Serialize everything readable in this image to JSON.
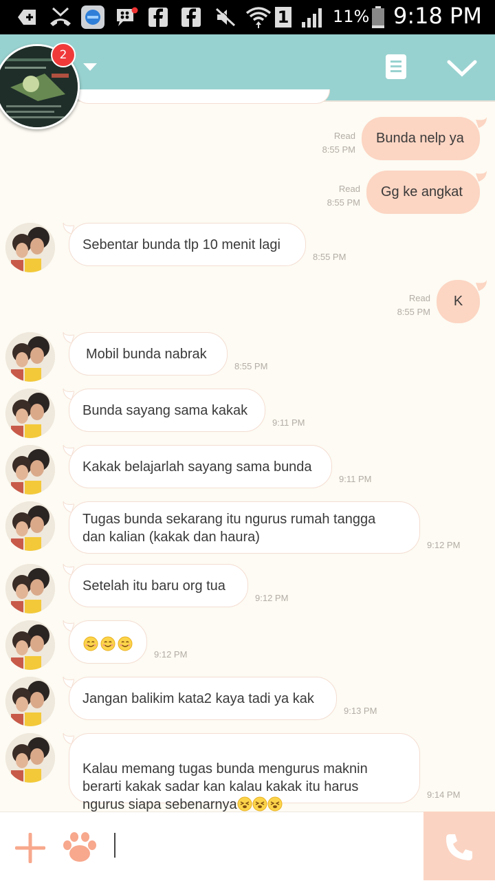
{
  "status_bar": {
    "battery": "11%",
    "time": "9:18 PM",
    "sim_number": "1",
    "icons": [
      "add-icon",
      "missed-call-icon",
      "blue-app-icon",
      "bbm-icon",
      "facebook-icon",
      "facebook-icon",
      "mute-icon",
      "wifi-icon",
      "sim-icon",
      "signal-icon",
      "battery-icon"
    ]
  },
  "header": {
    "badge": "2",
    "icons": [
      "dropdown-arrow-icon",
      "notes-icon",
      "chevron-down-icon"
    ],
    "color": "#98d2d0"
  },
  "messages": [
    {
      "dir": "out",
      "text": "Bunda nelp ya",
      "read": "Read",
      "time": "8:55 PM"
    },
    {
      "dir": "out",
      "text": "Gg ke angkat",
      "read": "Read",
      "time": "8:55 PM"
    },
    {
      "dir": "in",
      "text": "Sebentar bunda tlp 10 menit lagi",
      "time": "8:55 PM"
    },
    {
      "dir": "out",
      "text": "K",
      "read": "Read",
      "time": "8:55 PM"
    },
    {
      "dir": "in",
      "text": "Mobil bunda nabrak",
      "time": "8:55 PM"
    },
    {
      "dir": "in",
      "text": "Bunda sayang sama kakak",
      "time": "9:11 PM"
    },
    {
      "dir": "in",
      "text": "Kakak belajarlah sayang sama bunda",
      "time": "9:11 PM"
    },
    {
      "dir": "in",
      "text": "Tugas bunda sekarang itu ngurus rumah tangga\ndan kalian (kakak dan haura)",
      "time": "9:12 PM"
    },
    {
      "dir": "in",
      "text": "Setelah itu baru org tua",
      "time": "9:12 PM"
    },
    {
      "dir": "in",
      "text": "",
      "emoji": [
        "smile",
        "smile",
        "smile"
      ],
      "time": "9:12 PM"
    },
    {
      "dir": "in",
      "text": "Jangan balikim kata2 kaya tadi ya kak",
      "time": "9:13 PM"
    },
    {
      "dir": "in",
      "text": "Kalau memang tugas bunda mengurus maknin\nberarti kakak sadar kan kalau kakak itu harus\nngurus siapa sebenarnya",
      "emoji": [
        "tired",
        "tired",
        "tired"
      ],
      "time": "9:14 PM"
    }
  ],
  "input_bar": {
    "icons": [
      "plus-icon",
      "paw-sticker-icon",
      "phone-icon"
    ],
    "accent": "#f7a88d"
  }
}
